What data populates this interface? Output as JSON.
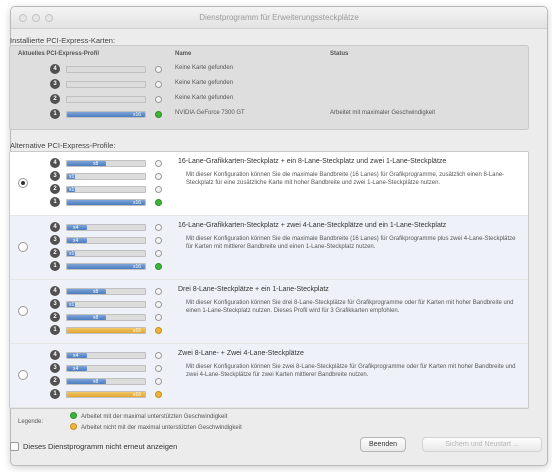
{
  "window": {
    "title": "Dienstprogramm für Erweiterungssteckplätze"
  },
  "installed": {
    "section_label": "Installierte PCI-Express-Karten:",
    "headers": [
      "Aktuelles PCI-Express-Profil",
      "Name",
      "Status"
    ],
    "rows": [
      {
        "slot": "4",
        "name": "Keine Karte gefunden",
        "status": "",
        "lanes": "",
        "fill": 0,
        "state": "empty"
      },
      {
        "slot": "3",
        "name": "Keine Karte gefunden",
        "status": "",
        "lanes": "",
        "fill": 0,
        "state": "empty"
      },
      {
        "slot": "2",
        "name": "Keine Karte gefunden",
        "status": "",
        "lanes": "",
        "fill": 0,
        "state": "empty"
      },
      {
        "slot": "1",
        "name": "NVIDIA GeForce 7300 GT",
        "status": "Arbeitet mit maximaler Geschwindigkeit",
        "lanes": "x16",
        "fill": 1,
        "state": "green"
      }
    ]
  },
  "alternatives": {
    "section_label": "Alternative PCI-Express-Profile:",
    "profiles": [
      {
        "selected": true,
        "title": "16-Lane-Grafikkarten-Steckplatz + ein 8-Lane-Steckplatz und zwei 1-Lane-Steckplätze",
        "description": "Mit dieser Konfiguration können Sie die maximale Bandbreite (16 Lanes) für Grafikprogramme, zusätzlich einen 8-Lane-Steckplatz für eine zusätzliche Karte mit hoher Bandbreite und zwei 1-Lane-Steckplätze nutzen.",
        "slots": [
          {
            "n": "4",
            "lanes": "x8",
            "fill": 0.5,
            "state": "empty",
            "orange": false
          },
          {
            "n": "3",
            "lanes": "x1",
            "fill": 0.1,
            "state": "empty",
            "orange": false
          },
          {
            "n": "2",
            "lanes": "x1",
            "fill": 0.1,
            "state": "empty",
            "orange": false
          },
          {
            "n": "1",
            "lanes": "x16",
            "fill": 1,
            "state": "green",
            "orange": false
          }
        ]
      },
      {
        "selected": false,
        "title": "16-Lane-Grafikkarten-Steckplatz + zwei 4-Lane-Steckplätze und ein 1-Lane-Steckplatz",
        "description": "Mit dieser Konfiguration können Sie die maximale Bandbreite (16 Lanes) für Grafikprogramme plus zwei 4-Lane-Steckplätze für Karten mit mittlerer Bandbreite und einen 1-Lane-Steckplatz nutzen.",
        "slots": [
          {
            "n": "4",
            "lanes": "x4",
            "fill": 0.25,
            "state": "empty",
            "orange": false
          },
          {
            "n": "3",
            "lanes": "x4",
            "fill": 0.25,
            "state": "empty",
            "orange": false
          },
          {
            "n": "2",
            "lanes": "x1",
            "fill": 0.1,
            "state": "empty",
            "orange": false
          },
          {
            "n": "1",
            "lanes": "x16",
            "fill": 1,
            "state": "green",
            "orange": false
          }
        ]
      },
      {
        "selected": false,
        "title": "Drei 8-Lane-Steckplätze + ein 1-Lane-Steckplatz",
        "description": "Mit dieser Konfiguration können Sie drei 8-Lane-Steckplätze für Grafikprogramme oder für Karten mit hoher Bandbreite und einen 1-Lane-Steckplatz nutzen. Dieses Profil wird für 3 Grafikkarten empfohlen.",
        "slots": [
          {
            "n": "4",
            "lanes": "x8",
            "fill": 0.5,
            "state": "empty",
            "orange": false
          },
          {
            "n": "3",
            "lanes": "x1",
            "fill": 0.1,
            "state": "empty",
            "orange": false
          },
          {
            "n": "2",
            "lanes": "x8",
            "fill": 0.5,
            "state": "empty",
            "orange": false
          },
          {
            "n": "1",
            "lanes": "x16",
            "fill": 1,
            "state": "orange",
            "orange": true
          }
        ]
      },
      {
        "selected": false,
        "title": "Zwei 8-Lane- + Zwei 4-Lane-Steckplätze",
        "description": "Mit dieser Konfiguration können Sie zwei 8-Lane-Steckplätze für Grafikprogramme oder für Karten mit hoher Bandbreite und zwei 4-Lane-Steckplätze für zwei Karten mittlerer Bandbreite nutzen.",
        "slots": [
          {
            "n": "4",
            "lanes": "x4",
            "fill": 0.25,
            "state": "empty",
            "orange": false
          },
          {
            "n": "3",
            "lanes": "x4",
            "fill": 0.25,
            "state": "empty",
            "orange": false
          },
          {
            "n": "2",
            "lanes": "x8",
            "fill": 0.5,
            "state": "empty",
            "orange": false
          },
          {
            "n": "1",
            "lanes": "x16",
            "fill": 1,
            "state": "orange",
            "orange": true
          }
        ]
      }
    ]
  },
  "legend": {
    "title": "Legende:",
    "green": "Arbeitet mit der maximal unterstützten Geschwindigkeit",
    "orange": "Arbeitet nicht mit der maximal unterstützten Geschwindigkeit"
  },
  "footer": {
    "checkbox_label": "Dieses Dienstprogramm nicht erneut anzeigen",
    "quit_label": "Beenden",
    "save_restart_label": "Sichern und Neustart ..."
  }
}
